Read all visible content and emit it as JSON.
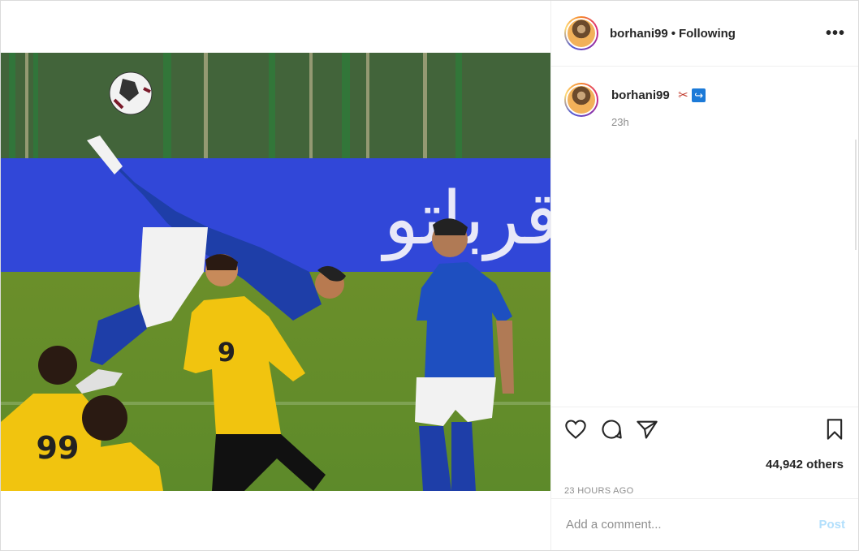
{
  "post": {
    "username": "borhani99",
    "dot": "•",
    "follow_status": "Following",
    "more_icon": "more-horizontal-icon",
    "caption_emoji_scissors": "✂",
    "caption_emoji_arrow": "↪",
    "time_relative": "23h",
    "likes": "44,942 others",
    "posted_ago": "23 HOURS AGO",
    "comment_placeholder": "Add a comment...",
    "post_button": "Post",
    "ad_banner_text": "قرباتو"
  },
  "colors": {
    "accent_link": "#b2dffc",
    "muted_text": "#8e8e8e",
    "border": "#dbdbdb"
  }
}
